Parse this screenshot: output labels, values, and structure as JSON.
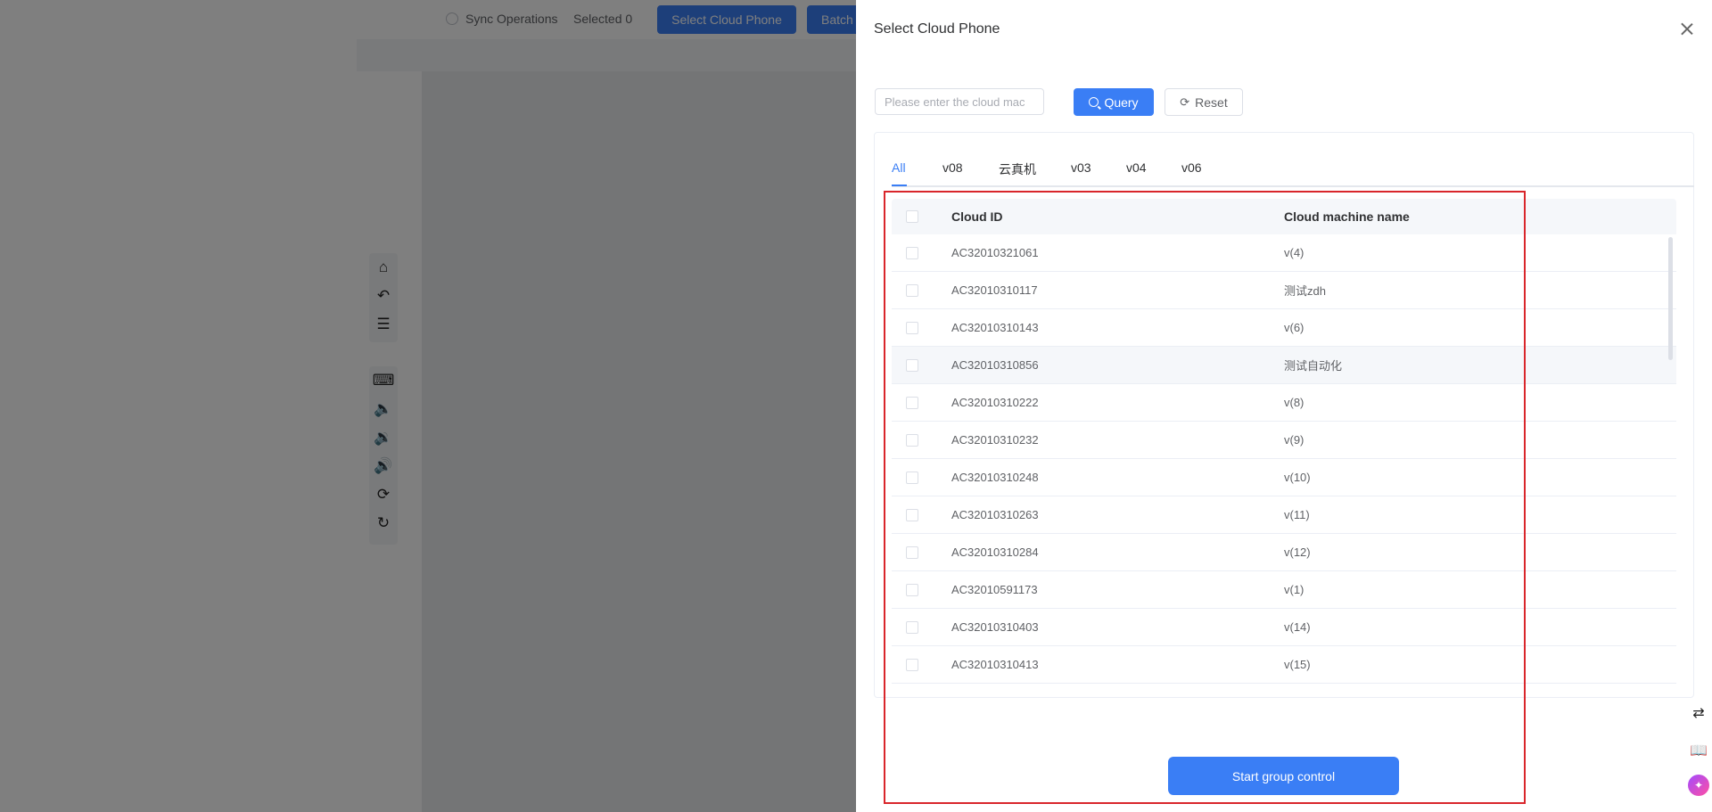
{
  "background": {
    "sync_label": "Sync Operations",
    "selected_label": "Selected 0",
    "select_button_label": "Select Cloud Phone",
    "batch_button_label": "Batch",
    "toolbar_top": [
      {
        "icon": "home-icon",
        "glyph": "⌂"
      },
      {
        "icon": "back-icon",
        "glyph": "↶"
      },
      {
        "icon": "menu-list-icon",
        "glyph": "☰"
      }
    ],
    "toolbar_bottom": [
      {
        "icon": "keyboard-icon",
        "glyph": "⌨"
      },
      {
        "icon": "volume-up-icon",
        "glyph": "🔈"
      },
      {
        "icon": "volume-down-icon",
        "glyph": "🔉"
      },
      {
        "icon": "volume-icon",
        "glyph": "🔊"
      },
      {
        "icon": "rotate-icon",
        "glyph": "⟳"
      },
      {
        "icon": "refresh-icon",
        "glyph": "↻"
      }
    ]
  },
  "drawer": {
    "title": "Select Cloud Phone",
    "search_placeholder": "Please enter the cloud mac",
    "query_label": "Query",
    "reset_label": "Reset",
    "reset_glyph": "⟳",
    "tabs": [
      "All",
      "v08",
      "云真机",
      "v03",
      "v04",
      "v06"
    ],
    "active_tab": "All",
    "table": {
      "headers": [
        "Cloud ID",
        "Cloud machine name"
      ],
      "rows": [
        [
          "AC32010321061",
          "v(4)"
        ],
        [
          "AC32010310117",
          "测试zdh"
        ],
        [
          "AC32010310143",
          "v(6)"
        ],
        [
          "AC32010310856",
          "测试自动化"
        ],
        [
          "AC32010310222",
          "v(8)"
        ],
        [
          "AC32010310232",
          "v(9)"
        ],
        [
          "AC32010310248",
          "v(10)"
        ],
        [
          "AC32010310263",
          "v(11)"
        ],
        [
          "AC32010310284",
          "v(12)"
        ],
        [
          "AC32010591173",
          "v(1)"
        ],
        [
          "AC32010310403",
          "v(14)"
        ],
        [
          "AC32010310413",
          "v(15)"
        ]
      ]
    },
    "start_button_label": "Start group control",
    "side_icons": [
      {
        "icon": "translate-icon",
        "glyph": "⇄"
      },
      {
        "icon": "book-icon",
        "glyph": "📖"
      },
      {
        "icon": "ai-assistant-icon",
        "glyph": "✦"
      }
    ]
  },
  "colors": {
    "accent": "#3a7ef5",
    "highlight_border": "#d9262b"
  }
}
